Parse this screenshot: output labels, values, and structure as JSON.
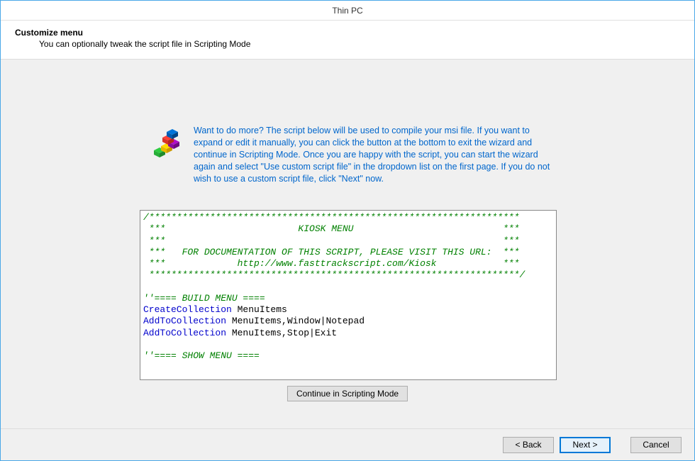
{
  "window": {
    "title": "Thin PC"
  },
  "header": {
    "title": "Customize menu",
    "subtitle": "You can optionally tweak the script file in Scripting Mode"
  },
  "info": {
    "text": "Want to do more? The script below will be used to compile your msi file. If you want to expand or edit it manually, you can click the button at the bottom to exit the wizard and continue in Scripting Mode. Once you are happy with the script, you can start the wizard again and select \"Use custom script file\" in the dropdown list on the first page. If you do not wish to use a custom script file, click \"Next\" now."
  },
  "script": {
    "lines": [
      [
        {
          "t": "/*******************************************************************",
          "c": "green"
        }
      ],
      [
        {
          "t": " ***                        KIOSK MENU                           ***",
          "c": "green"
        }
      ],
      [
        {
          "t": " ***                                                             ***",
          "c": "green"
        }
      ],
      [
        {
          "t": " ***   FOR DOCUMENTATION OF THIS SCRIPT, PLEASE VISIT THIS URL:  ***",
          "c": "green"
        }
      ],
      [
        {
          "t": " ***             http://www.fasttrackscript.com/Kiosk            ***",
          "c": "green"
        }
      ],
      [
        {
          "t": " *******************************************************************/",
          "c": "green"
        }
      ],
      [
        {
          "t": "",
          "c": "black"
        }
      ],
      [
        {
          "t": "''==== BUILD MENU ====",
          "c": "green"
        }
      ],
      [
        {
          "t": "CreateCollection",
          "c": "blue"
        },
        {
          "t": " MenuItems",
          "c": "black"
        }
      ],
      [
        {
          "t": "AddToCollection",
          "c": "blue"
        },
        {
          "t": " MenuItems,Window|Notepad",
          "c": "black"
        }
      ],
      [
        {
          "t": "AddToCollection",
          "c": "blue"
        },
        {
          "t": " MenuItems,Stop|Exit",
          "c": "black"
        }
      ],
      [
        {
          "t": "",
          "c": "black"
        }
      ],
      [
        {
          "t": "''==== SHOW MENU ====",
          "c": "green"
        }
      ]
    ]
  },
  "buttons": {
    "scripting": "Continue in Scripting Mode",
    "back": "< Back",
    "next": "Next >",
    "cancel": "Cancel"
  }
}
